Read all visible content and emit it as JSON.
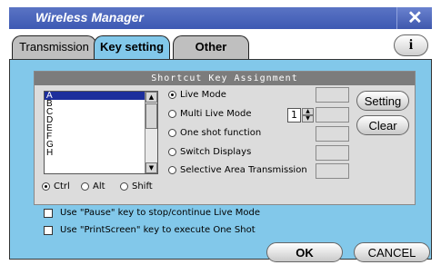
{
  "window": {
    "title": "Wireless Manager"
  },
  "tabs": [
    "Transmission",
    "Key setting",
    "Other"
  ],
  "group": {
    "title": "Shortcut Key Assignment"
  },
  "list": {
    "items": [
      "A",
      "B",
      "C",
      "D",
      "E",
      "F",
      "G",
      "H"
    ],
    "selected": "A"
  },
  "options": {
    "live_mode": "Live Mode",
    "multi_live_mode": "Multi Live Mode",
    "one_shot": "One shot function",
    "switch_displays": "Switch Displays",
    "selective_area": "Selective Area Transmission"
  },
  "multi_live_value": "1",
  "modifiers": [
    "Ctrl",
    "Alt",
    "Shift"
  ],
  "buttons": {
    "setting": "Setting",
    "clear": "Clear",
    "ok": "OK",
    "cancel": "CANCEL"
  },
  "checkboxes": [
    "Use \"Pause\" key to stop/continue Live Mode",
    "Use \"PrintScreen\" key to execute One Shot"
  ],
  "colors": {
    "title_bar": "#3d59b3",
    "panel": "#82c8ea",
    "selected_item": "#1d2f9c"
  }
}
